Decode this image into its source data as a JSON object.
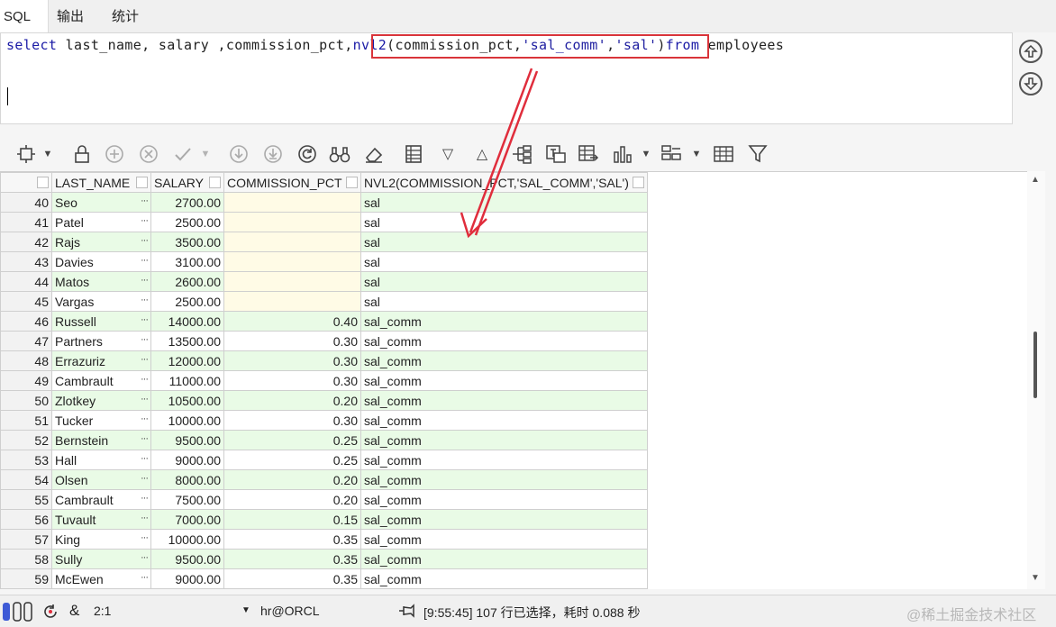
{
  "tabs": [
    {
      "label": "SQL",
      "active": true
    },
    {
      "label": "输出",
      "active": false
    },
    {
      "label": "统计",
      "active": false
    }
  ],
  "editor": {
    "tokens": [
      {
        "text": "select",
        "cls": "kw"
      },
      {
        "text": " last_name, salary ,commission_pct,",
        "cls": "plain"
      },
      {
        "text": "nvl2",
        "cls": "kw"
      },
      {
        "text": "(commission_pct,",
        "cls": "plain"
      },
      {
        "text": "'sal_comm'",
        "cls": "str"
      },
      {
        "text": ",",
        "cls": "plain"
      },
      {
        "text": "'sal'",
        "cls": "str"
      },
      {
        "text": ")",
        "cls": "plain"
      },
      {
        "text": "from",
        "cls": "kw"
      },
      {
        "text": " employees",
        "cls": "plain"
      }
    ]
  },
  "grid": {
    "columns": [
      "LAST_NAME",
      "SALARY",
      "COMMISSION_PCT",
      "NVL2(COMMISSION_PCT,'SAL_COMM','SAL')"
    ],
    "rows": [
      {
        "n": "40",
        "last_name": "Seo",
        "salary": "2700.00",
        "pct": "",
        "nvl2": "sal"
      },
      {
        "n": "41",
        "last_name": "Patel",
        "salary": "2500.00",
        "pct": "",
        "nvl2": "sal"
      },
      {
        "n": "42",
        "last_name": "Rajs",
        "salary": "3500.00",
        "pct": "",
        "nvl2": "sal"
      },
      {
        "n": "43",
        "last_name": "Davies",
        "salary": "3100.00",
        "pct": "",
        "nvl2": "sal"
      },
      {
        "n": "44",
        "last_name": "Matos",
        "salary": "2600.00",
        "pct": "",
        "nvl2": "sal"
      },
      {
        "n": "45",
        "last_name": "Vargas",
        "salary": "2500.00",
        "pct": "",
        "nvl2": "sal"
      },
      {
        "n": "46",
        "last_name": "Russell",
        "salary": "14000.00",
        "pct": "0.40",
        "nvl2": "sal_comm"
      },
      {
        "n": "47",
        "last_name": "Partners",
        "salary": "13500.00",
        "pct": "0.30",
        "nvl2": "sal_comm"
      },
      {
        "n": "48",
        "last_name": "Errazuriz",
        "salary": "12000.00",
        "pct": "0.30",
        "nvl2": "sal_comm"
      },
      {
        "n": "49",
        "last_name": "Cambrault",
        "salary": "11000.00",
        "pct": "0.30",
        "nvl2": "sal_comm"
      },
      {
        "n": "50",
        "last_name": "Zlotkey",
        "salary": "10500.00",
        "pct": "0.20",
        "nvl2": "sal_comm"
      },
      {
        "n": "51",
        "last_name": "Tucker",
        "salary": "10000.00",
        "pct": "0.30",
        "nvl2": "sal_comm"
      },
      {
        "n": "52",
        "last_name": "Bernstein",
        "salary": "9500.00",
        "pct": "0.25",
        "nvl2": "sal_comm"
      },
      {
        "n": "53",
        "last_name": "Hall",
        "salary": "9000.00",
        "pct": "0.25",
        "nvl2": "sal_comm"
      },
      {
        "n": "54",
        "last_name": "Olsen",
        "salary": "8000.00",
        "pct": "0.20",
        "nvl2": "sal_comm"
      },
      {
        "n": "55",
        "last_name": "Cambrault",
        "salary": "7500.00",
        "pct": "0.20",
        "nvl2": "sal_comm"
      },
      {
        "n": "56",
        "last_name": "Tuvault",
        "salary": "7000.00",
        "pct": "0.15",
        "nvl2": "sal_comm"
      },
      {
        "n": "57",
        "last_name": "King",
        "salary": "10000.00",
        "pct": "0.35",
        "nvl2": "sal_comm"
      },
      {
        "n": "58",
        "last_name": "Sully",
        "salary": "9500.00",
        "pct": "0.35",
        "nvl2": "sal_comm"
      },
      {
        "n": "59",
        "last_name": "McEwen",
        "salary": "9000.00",
        "pct": "0.35",
        "nvl2": "sal_comm"
      }
    ],
    "cell_more": "···"
  },
  "status": {
    "cursor_pos": "2:1",
    "connection": "hr@ORCL",
    "message": "[9:55:45]  107 行已选择，耗时 0.088 秒",
    "watermark": "@稀土掘金技术社区"
  },
  "colors": {
    "keyword": "#1a1aa6",
    "highlight_box": "#d9343a",
    "arrow": "#e02d3c",
    "row_green": "#e9fbe6",
    "null_cell": "#fffbe6"
  }
}
